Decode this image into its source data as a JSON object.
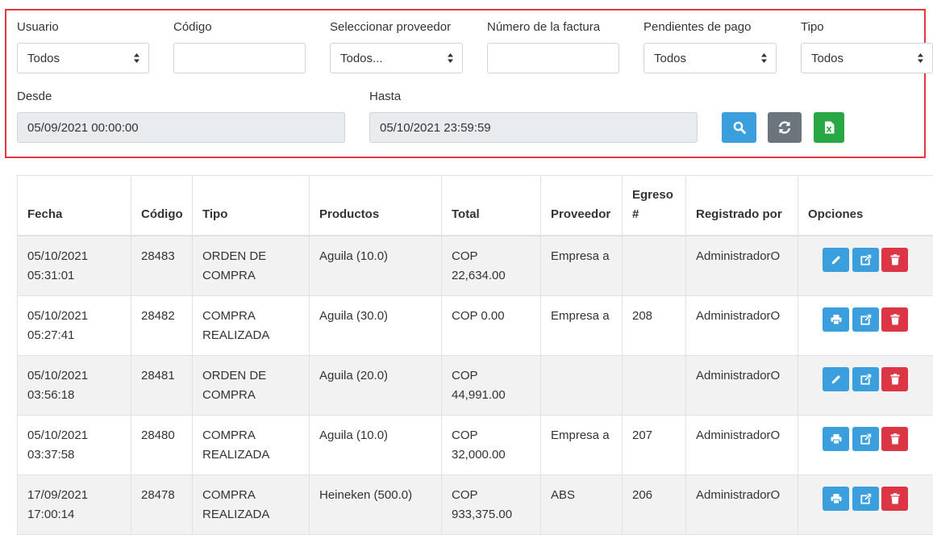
{
  "filters": {
    "usuario": {
      "label": "Usuario",
      "value": "Todos"
    },
    "codigo": {
      "label": "Código",
      "value": ""
    },
    "proveedor": {
      "label": "Seleccionar proveedor",
      "value": "Todos..."
    },
    "factura": {
      "label": "Número de la factura",
      "value": ""
    },
    "pendientes": {
      "label": "Pendientes de pago",
      "value": "Todos"
    },
    "tipo": {
      "label": "Tipo",
      "value": "Todos"
    },
    "desde": {
      "label": "Desde",
      "value": "05/09/2021 00:00:00"
    },
    "hasta": {
      "label": "Hasta",
      "value": "05/10/2021 23:59:59"
    }
  },
  "table": {
    "headers": {
      "fecha": "Fecha",
      "codigo": "Código",
      "tipo": "Tipo",
      "productos": "Productos",
      "total": "Total",
      "proveedor": "Proveedor",
      "egreso": "Egreso #",
      "registrado": "Registrado por",
      "opciones": "Opciones"
    },
    "rows": [
      {
        "fecha": "05/10/2021 05:31:01",
        "codigo": "28483",
        "tipo": "ORDEN DE COMPRA",
        "productos": "Aguila (10.0)",
        "total": "COP 22,634.00",
        "proveedor": "Empresa a",
        "egreso": "",
        "registrado": "AdministradorO",
        "first_action": "edit-icon"
      },
      {
        "fecha": "05/10/2021 05:27:41",
        "codigo": "28482",
        "tipo": "COMPRA REALIZADA",
        "productos": "Aguila (30.0)",
        "total": "COP 0.00",
        "proveedor": "Empresa a",
        "egreso": "208",
        "registrado": "AdministradorO",
        "first_action": "print-icon"
      },
      {
        "fecha": "05/10/2021 03:56:18",
        "codigo": "28481",
        "tipo": "ORDEN DE COMPRA",
        "productos": "Aguila (20.0)",
        "total": "COP 44,991.00",
        "proveedor": "",
        "egreso": "",
        "registrado": "AdministradorO",
        "first_action": "edit-icon"
      },
      {
        "fecha": "05/10/2021 03:37:58",
        "codigo": "28480",
        "tipo": "COMPRA REALIZADA",
        "productos": "Aguila (10.0)",
        "total": "COP 32,000.00",
        "proveedor": "Empresa a",
        "egreso": "207",
        "registrado": "AdministradorO",
        "first_action": "print-icon"
      },
      {
        "fecha": "17/09/2021 17:00:14",
        "codigo": "28478",
        "tipo": "COMPRA REALIZADA",
        "productos": "Heineken (500.0)",
        "total": "COP 933,375.00",
        "proveedor": "ABS",
        "egreso": "206",
        "registrado": "AdministradorO",
        "first_action": "print-icon"
      }
    ]
  },
  "colors": {
    "highlight_border": "#e0393e",
    "search": "#3b9fde",
    "refresh": "#6c757d",
    "excel": "#28a745",
    "action_blue": "#3b9fde",
    "action_red": "#dc3545"
  }
}
